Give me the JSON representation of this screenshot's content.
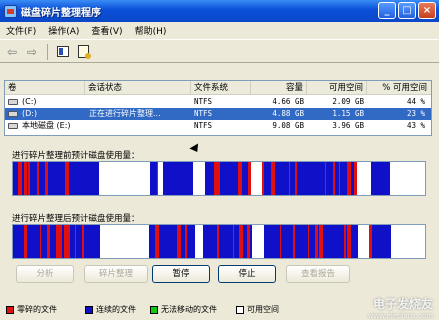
{
  "window": {
    "title": "磁盘碎片整理程序",
    "buttons": [
      "_",
      "□",
      "×"
    ]
  },
  "menu": [
    "文件(F)",
    "操作(A)",
    "查看(V)",
    "帮助(H)"
  ],
  "toolbar": {
    "back_icon": "back-arrow-icon",
    "forward_icon": "forward-arrow-icon",
    "view_icon": "console-tree-icon",
    "props_icon": "properties-icon"
  },
  "volumes": {
    "columns": [
      "卷",
      "会话状态",
      "文件系统",
      "容量",
      "可用空间",
      "% 可用空间"
    ],
    "rows": [
      {
        "name": "(C:)",
        "status": "",
        "fs": "NTFS",
        "capacity": "4.66 GB",
        "free": "2.09 GB",
        "pct": "44 %",
        "selected": false
      },
      {
        "name": "(D:)",
        "status": "正在进行碎片整理...",
        "fs": "NTFS",
        "capacity": "4.88 GB",
        "free": "1.15 GB",
        "pct": "23 %",
        "selected": true
      },
      {
        "name": "本地磁盘 (E:)",
        "status": "",
        "fs": "NTFS",
        "capacity": "9.08 GB",
        "free": "3.96 GB",
        "pct": "43 %",
        "selected": false
      }
    ]
  },
  "before_label": "进行碎片整理前预计磁盘使用量：",
  "after_label": "进行碎片整理后预计磁盘使用量：",
  "buttons": {
    "analyze": "分析",
    "defrag": "碎片整理",
    "pause": "暂停",
    "stop": "停止",
    "report": "查看报告"
  },
  "legend": [
    {
      "label": "零碎的文件",
      "color": "#e01010"
    },
    {
      "label": "连续的文件",
      "color": "#1010c8"
    },
    {
      "label": "无法移动的文件",
      "color": "#10c810"
    },
    {
      "label": "可用空间",
      "color": "#ffffff"
    }
  ],
  "watermark": {
    "main": "电子发烧友",
    "sub": "www.elecfans.com"
  }
}
